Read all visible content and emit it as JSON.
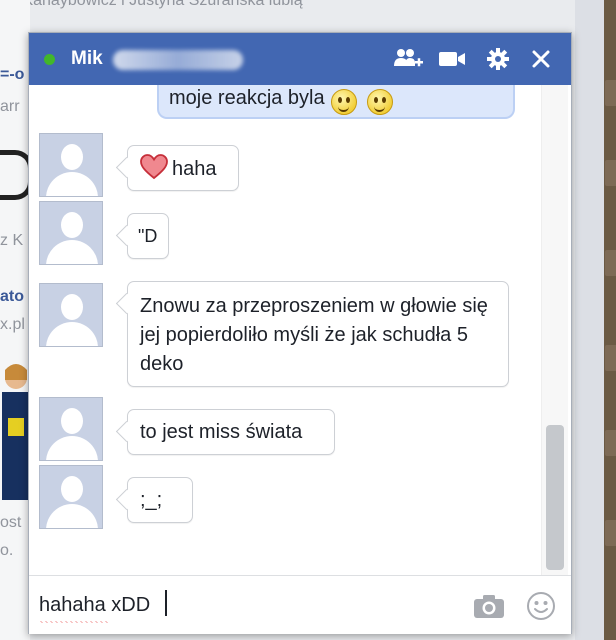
{
  "background": {
    "top_text": "z Kanaybowicz i Justyna Szurańska lubią",
    "snippets": [
      "=-o",
      "arr",
      "z K",
      "ato",
      "x.pl",
      "ost",
      "o."
    ]
  },
  "chat": {
    "contact_name": "Mik",
    "header_icons": [
      "add-friend-icon",
      "video-call-icon",
      "gear-icon",
      "close-icon"
    ],
    "messages": {
      "own_reply": "moje reakcja byla",
      "heart_haha": "haha",
      "quote_d": "\"D",
      "long": "Znowu za przeproszeniem w głowie się jej popierdoliło myśli że jak schudła 5 deko",
      "miss": "to jest miss świata",
      "cry": ";_;"
    },
    "composer": {
      "value": "hahaha xDD"
    },
    "colors": {
      "header": "#4267b2",
      "presence": "#42b72a",
      "own_bubble": "#dce7fb"
    }
  }
}
